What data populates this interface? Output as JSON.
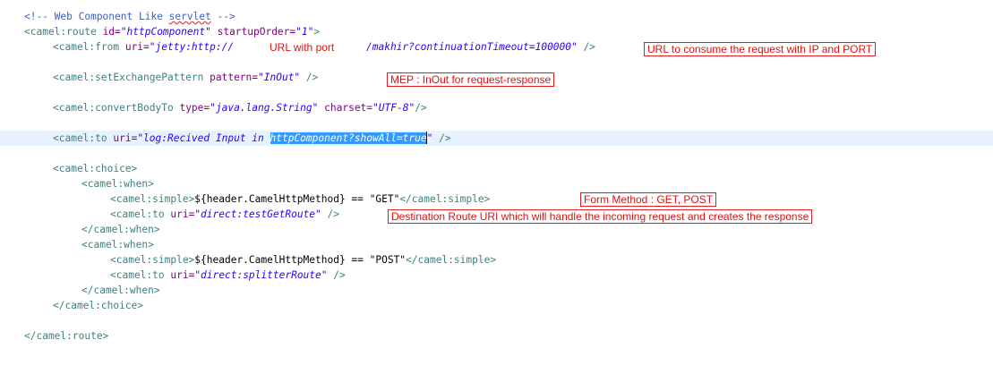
{
  "editor": {
    "lines": {
      "l1": {
        "comment": "<!-- Web Component Like ",
        "spell": "servlet",
        "close": " -->"
      },
      "l2": {
        "open": "<camel:route ",
        "a1": "id=",
        "v1": "\"httpComponent\"",
        "sp": " ",
        "a2": "startupOrder=",
        "v2": "\"1\"",
        "close": ">"
      },
      "l3": {
        "open": "<camel:from ",
        "a1": "uri=",
        "v1a": "\"jetty:http://",
        "v1b": "/makhir?continuationTimeout=100000\"",
        "close": " />"
      },
      "l4": {
        "open": "<camel:setExchangePattern ",
        "a1": "pattern=",
        "v1": "\"InOut\"",
        "close": " />"
      },
      "l5": {
        "open": "<camel:convertBodyTo ",
        "a1": "type=",
        "v1": "\"java.lang.String\"",
        "sp": " ",
        "a2": "charset=",
        "v2": "\"UTF-8\"",
        "close": "/>"
      },
      "l6": {
        "open": "<camel:to ",
        "a1": "uri=",
        "v1a": "\"log:Recived Input in ",
        "v1sel": "httpComponent?showAll=true",
        "v1b": "\"",
        "close": " />"
      },
      "l7": {
        "open": "<camel:choice>"
      },
      "l8": {
        "open": "<camel:when>"
      },
      "l9": {
        "open": "<camel:simple>",
        "text": "${header.CamelHttpMethod} == \"GET\"",
        "close": "</camel:simple>"
      },
      "l10": {
        "open": "<camel:to ",
        "a1": "uri=",
        "v1": "\"direct:testGetRoute\"",
        "close": " />"
      },
      "l11": {
        "open": "</camel:when>"
      },
      "l12": {
        "open": "<camel:when>"
      },
      "l13": {
        "open": "<camel:simple>",
        "text": "${header.CamelHttpMethod} == \"POST\"",
        "close": "</camel:simple>"
      },
      "l14": {
        "open": "<camel:to ",
        "a1": "uri=",
        "v1": "\"direct:splitterRoute\"",
        "close": " />"
      },
      "l15": {
        "open": "</camel:when>"
      },
      "l16": {
        "open": "</camel:choice>"
      },
      "l17": {
        "open": "</camel:route>"
      }
    }
  },
  "annotations": {
    "url_with_port": "URL with port",
    "consume_url": "URL to consume the request with IP and PORT",
    "mep": "MEP : InOut for request-response",
    "form_method": "Form Method : GET, POST",
    "destination": "Destination Route URI which will handle the incoming request and creates the response"
  },
  "colors": {
    "comment": "#3f5fbf",
    "tag": "#3f7f7f",
    "attribute": "#7f007f",
    "value": "#2a00ff",
    "selection": "#3399ff",
    "annotation": "#e01010",
    "current_line": "#e8f2fe"
  }
}
